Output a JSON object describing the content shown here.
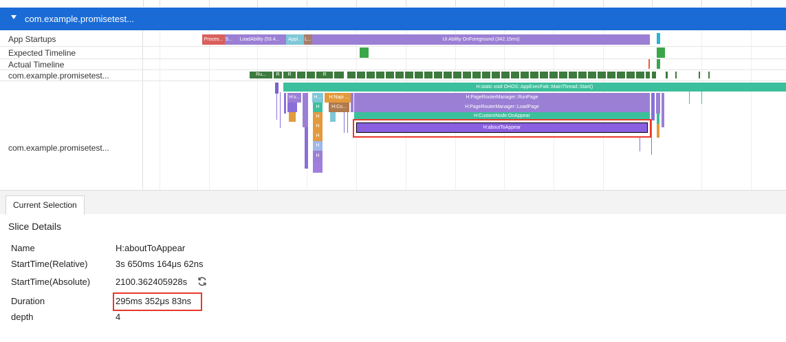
{
  "process": {
    "title": "com.example.promisetest..."
  },
  "lanes": {
    "app_startups": "App Startups",
    "expected_timeline": "Expected Timeline",
    "actual_timeline": "Actual Timeline",
    "thread_lane": "com.example.promisetest...",
    "main_thread": "com.example.promisetest..."
  },
  "startup_slices": [
    {
      "label": "Proces...",
      "color": "#d9605d"
    },
    {
      "label": "S...",
      "color": "#9b7fd4"
    },
    {
      "label": "LoadAbility (53.4...",
      "color": "#9b7fd4"
    },
    {
      "label": "Appl...",
      "color": "#7ec8d8"
    },
    {
      "label": "L...",
      "color": "#a77e6b"
    },
    {
      "label": "UI Ability OnForeground (342.15ms)",
      "color": "#9b7fd4"
    }
  ],
  "thread_slice_labels": [
    "Ru...",
    "R",
    "R",
    "R",
    "R",
    "R"
  ],
  "main_slices": {
    "main_thread_start": "H:static void OHOS::AppExecFwk::MainThread::Start()",
    "run_page": "H:PageRouterManager::RunPage",
    "load_page": "H:PageRouterManager::LoadPage",
    "custom_node": "H:CustomNode:OnAppear",
    "about_to_appear": "H:aboutToAppear",
    "h_v": "H:v...",
    "h_dot": "H...",
    "h_napi": "H:Napi ...",
    "h_co": "H:Co...",
    "h_small": [
      "H",
      "H",
      "H",
      "H",
      "H",
      "H",
      "H"
    ]
  },
  "colors": {
    "header_blue": "#1a6bd6",
    "main_teal": "#3bbf9c",
    "purple": "#9b7fd4",
    "violet": "#8a5fe0",
    "green": "#3aa64a",
    "dark_green": "#3d7a3d",
    "orange": "#e39a3c",
    "red_highlight": "#e8382c"
  },
  "tabs": {
    "current_selection": "Current Selection"
  },
  "details": {
    "title": "Slice Details",
    "name_key": "Name",
    "name_val": "H:aboutToAppear",
    "start_rel_key": "StartTime(Relative)",
    "start_rel_val": "3s 650ms 164μs 62ns",
    "start_abs_key": "StartTime(Absolute)",
    "start_abs_val": "2100.362405928s",
    "duration_key": "Duration",
    "duration_val": "295ms 352μs 83ns",
    "depth_key": "depth",
    "depth_val": "4"
  }
}
